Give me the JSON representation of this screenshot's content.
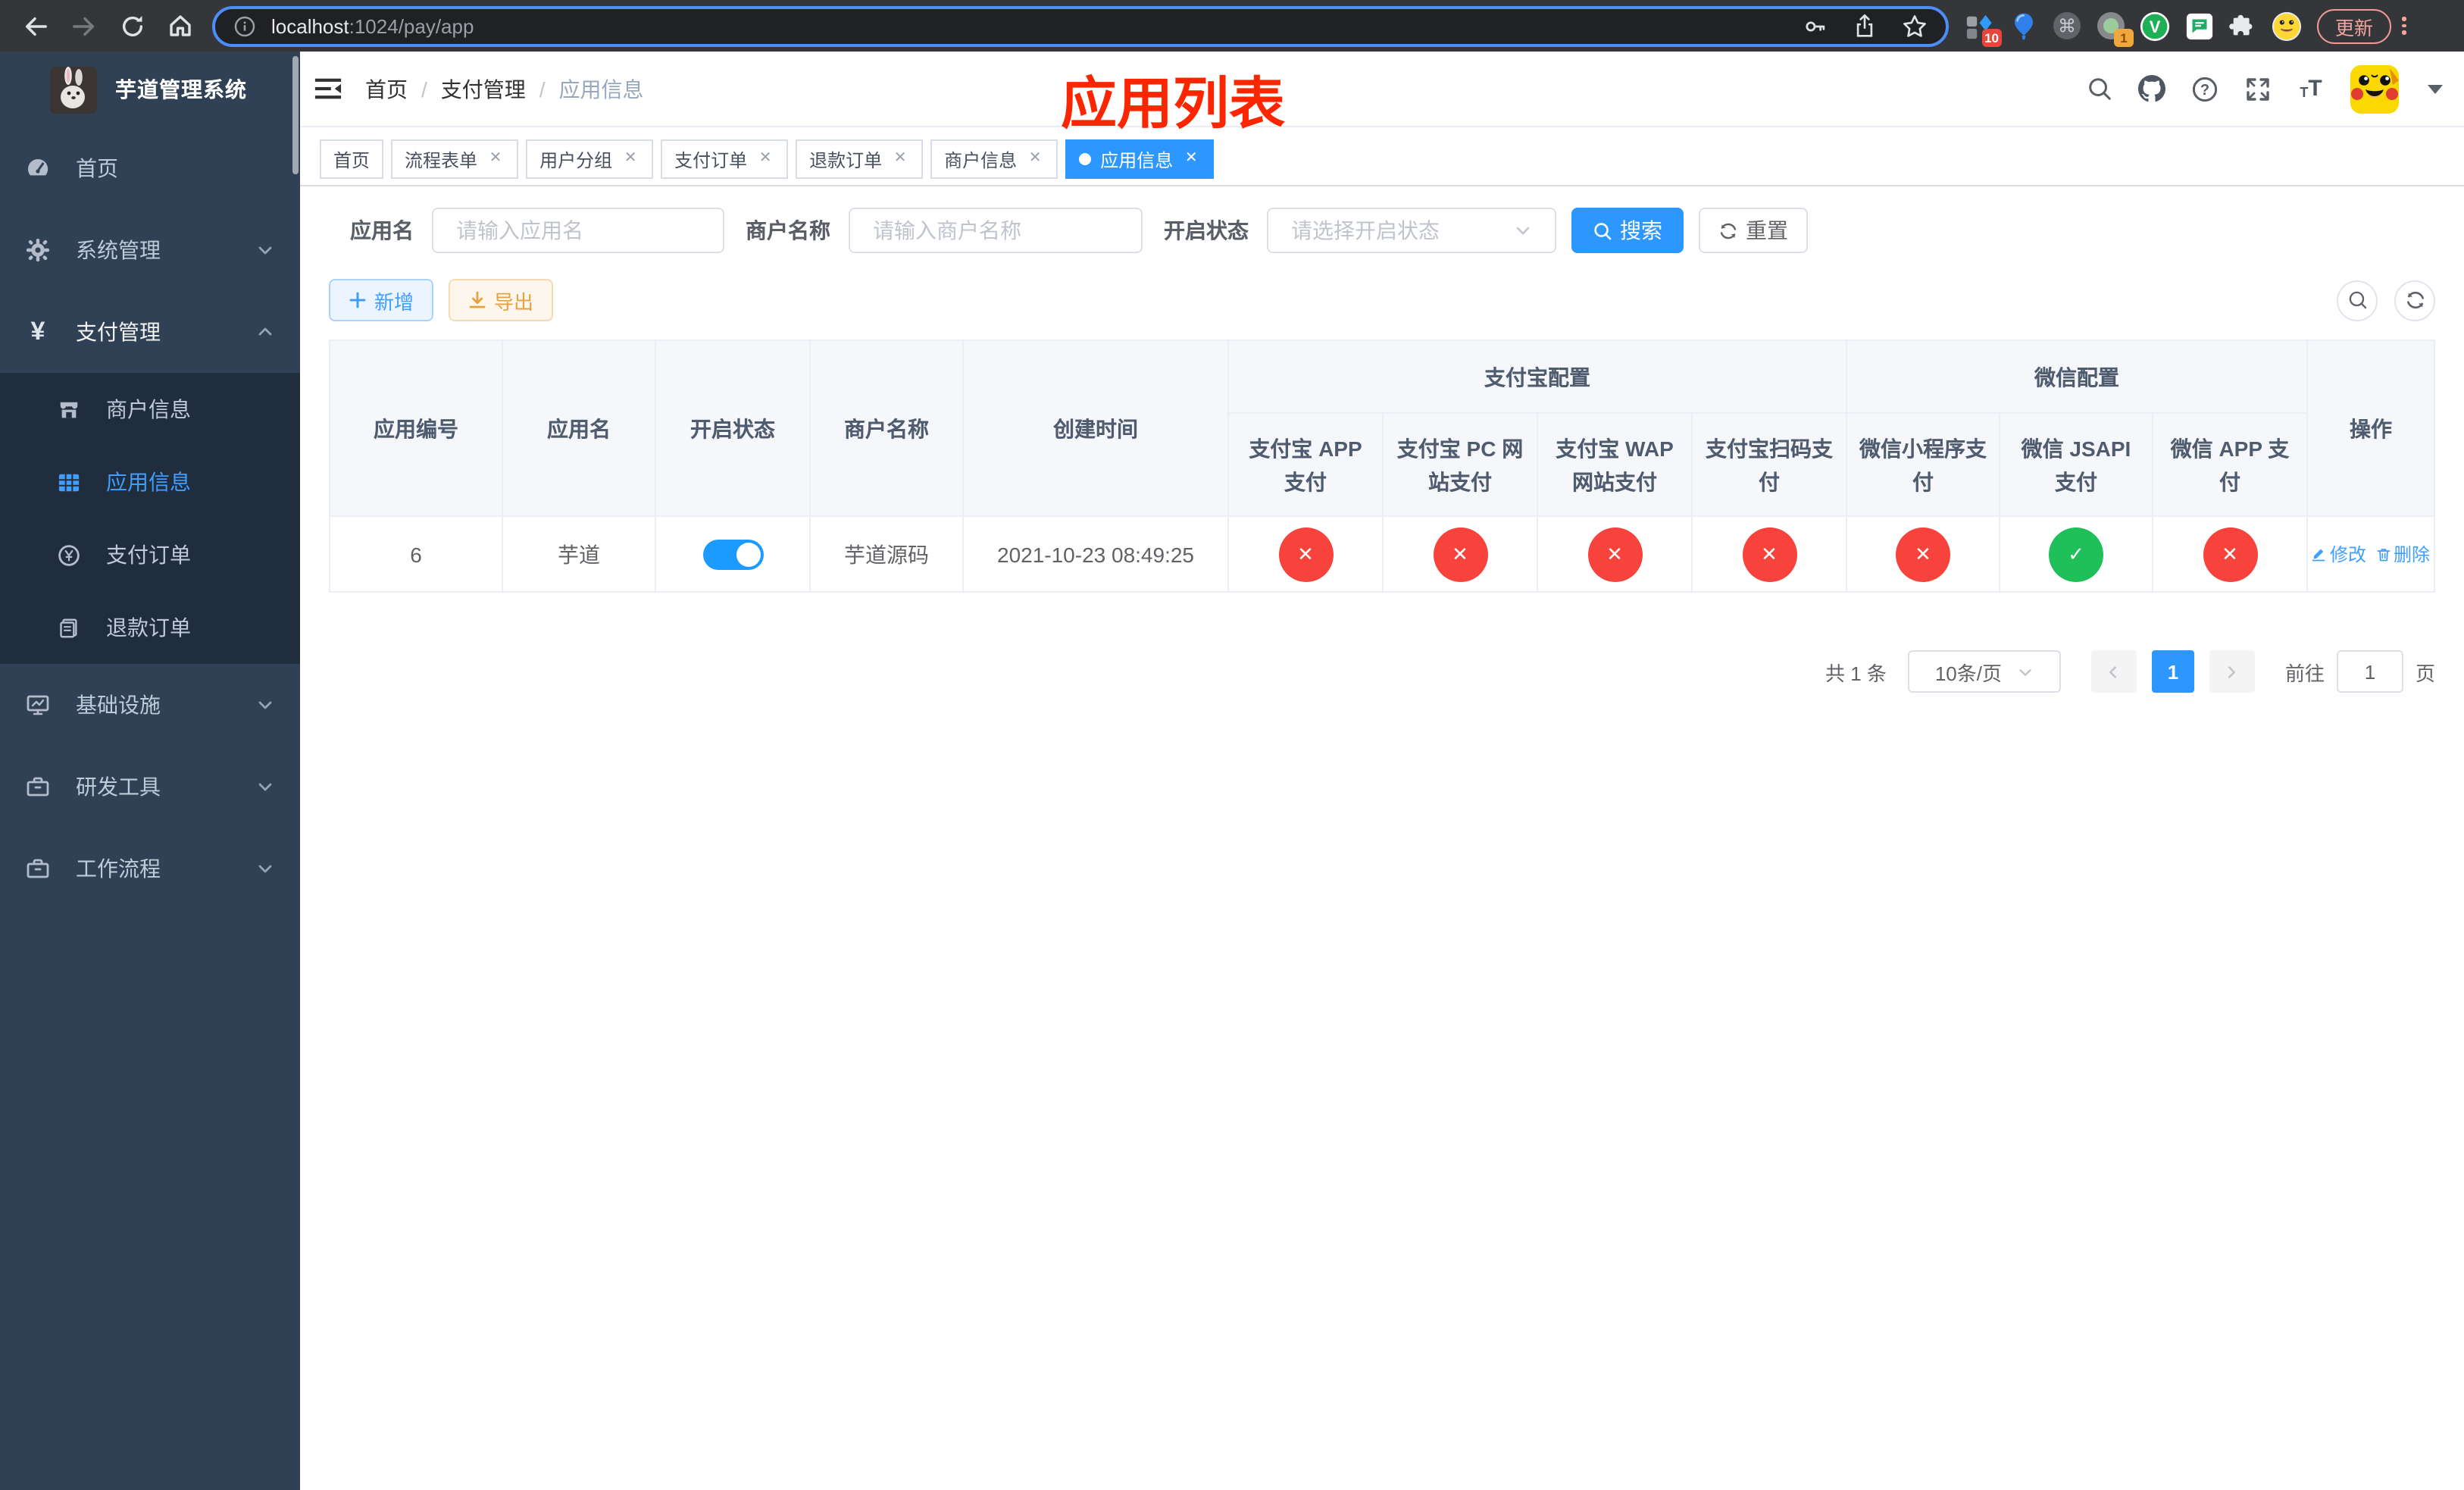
{
  "browser": {
    "url": {
      "host": "localhost",
      "path": ":1024/pay/app"
    },
    "extensions": {
      "badge_blue_diamond": "10",
      "badge_recorder": "1"
    },
    "update_button": "更新"
  },
  "sidebar": {
    "title": "芋道管理系统",
    "items": [
      {
        "label": "首页"
      },
      {
        "label": "系统管理"
      },
      {
        "label": "支付管理"
      },
      {
        "label": "商户信息"
      },
      {
        "label": "应用信息"
      },
      {
        "label": "支付订单"
      },
      {
        "label": "退款订单"
      },
      {
        "label": "基础设施"
      },
      {
        "label": "研发工具"
      },
      {
        "label": "工作流程"
      }
    ]
  },
  "header": {
    "breadcrumb": [
      "首页",
      "支付管理",
      "应用信息"
    ],
    "annotation": "应用列表"
  },
  "tabs": [
    {
      "label": "首页",
      "closable": false,
      "active": false
    },
    {
      "label": "流程表单",
      "closable": true,
      "active": false
    },
    {
      "label": "用户分组",
      "closable": true,
      "active": false
    },
    {
      "label": "支付订单",
      "closable": true,
      "active": false
    },
    {
      "label": "退款订单",
      "closable": true,
      "active": false
    },
    {
      "label": "商户信息",
      "closable": true,
      "active": false
    },
    {
      "label": "应用信息",
      "closable": true,
      "active": true
    }
  ],
  "filters": {
    "app_name_label": "应用名",
    "app_name_placeholder": "请输入应用名",
    "merchant_label": "商户名称",
    "merchant_placeholder": "请输入商户名称",
    "status_label": "开启状态",
    "status_placeholder": "请选择开启状态",
    "search_button": "搜索",
    "reset_button": "重置"
  },
  "toolbar": {
    "add_button": "新增",
    "export_button": "导出"
  },
  "table": {
    "simple_columns": [
      "应用编号",
      "应用名",
      "开启状态",
      "商户名称",
      "创建时间"
    ],
    "groups": [
      "支付宝配置",
      "微信配置"
    ],
    "pay_columns": [
      "支付宝 APP 支付",
      "支付宝 PC 网站支付",
      "支付宝 WAP 网站支付",
      "支付宝扫码支付",
      "微信小程序支付",
      "微信 JSAPI 支付",
      "微信 APP 支付"
    ],
    "action_column": "操作",
    "rows": [
      {
        "id": "6",
        "name": "芋道",
        "enabled": true,
        "merchant": "芋道源码",
        "created": "2021-10-23 08:49:25",
        "statuses": [
          false,
          false,
          false,
          false,
          false,
          true,
          false
        ],
        "edit": "修改",
        "delete": "删除"
      }
    ]
  },
  "pagination": {
    "total": "共 1 条",
    "size": "10条/页",
    "page": "1",
    "goto": "前往",
    "unit": "页",
    "goto_value": "1"
  },
  "glyphs": {
    "check": "✓",
    "cross": "✕"
  }
}
